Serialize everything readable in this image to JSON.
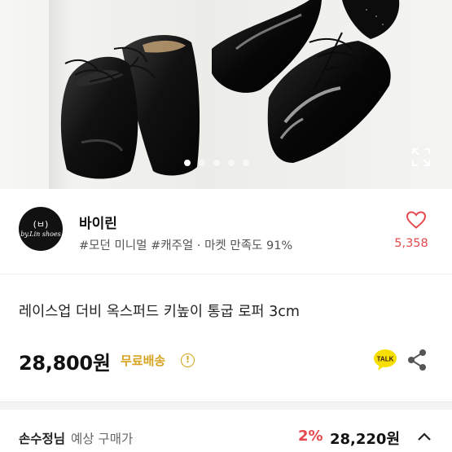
{
  "gallery": {
    "slide_count": 5,
    "active_slide": 1,
    "expand_icon": "expand-arrows-icon"
  },
  "seller": {
    "avatar_mark": "(ㅂ)",
    "avatar_brand": "by.Lin shoes",
    "name": "바이린",
    "tags": "#모던 미니멀 #캐주얼 · 마켓 만족도 91%",
    "like_icon": "heart-outline-icon",
    "like_count": "5,358"
  },
  "product": {
    "title": "레이스업 더비 옥스퍼드 키높이 통굽 로퍼 3cm",
    "price": "28,800원",
    "shipping": "무료배송",
    "info_icon_glyph": "!",
    "talk_label": "TALK",
    "share_icon": "share-icon"
  },
  "expected_price": {
    "who": "손수정님",
    "label": "예상 구매가",
    "discount": "2%",
    "price": "28,220원"
  },
  "colors": {
    "accent_red": "#e5484d",
    "free_shipping_gold": "#d7a320",
    "kakao_yellow": "#f7e000"
  }
}
